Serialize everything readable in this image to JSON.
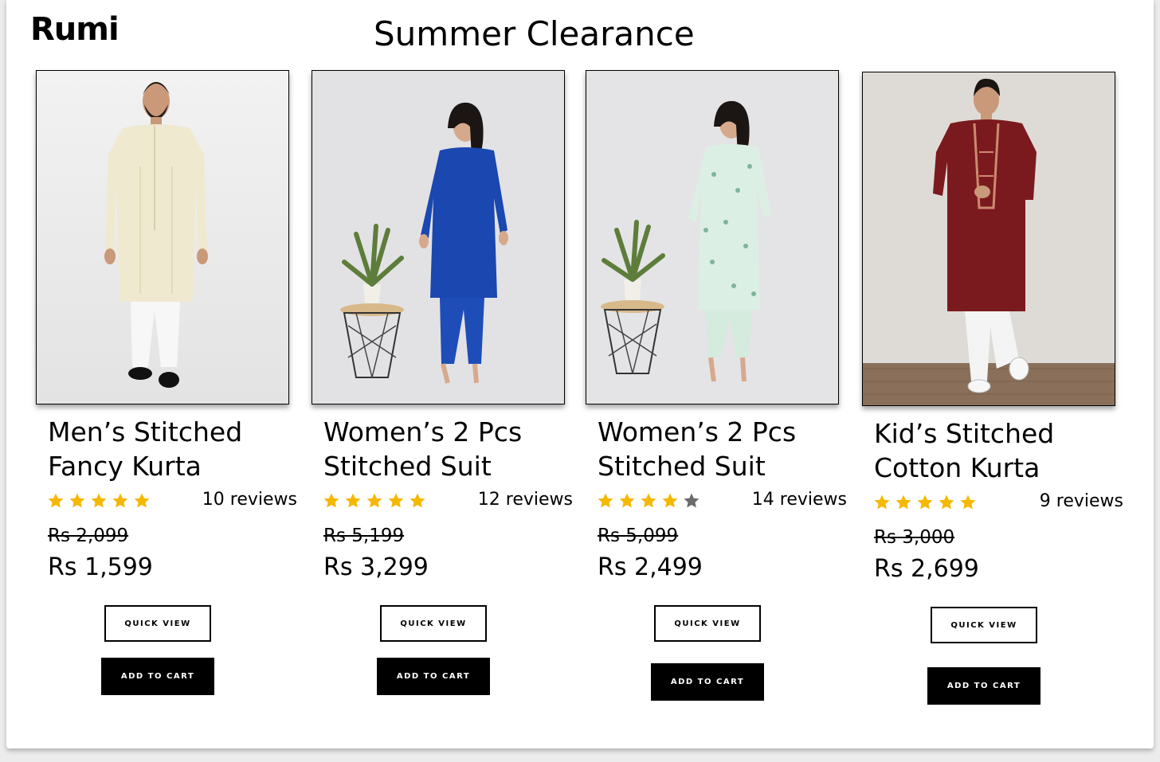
{
  "header": {
    "brand": "Rumi",
    "title": "Summer Clearance"
  },
  "colors": {
    "star_filled": "#F5B800",
    "star_empty": "#6B6B6B",
    "button_dark": "#000000"
  },
  "products": [
    {
      "name_line1": "Men’s Stitched",
      "name_line2": "Fancy Kurta",
      "rating": 5,
      "reviews": "10 reviews",
      "old_price": "Rs 2,099",
      "price": "Rs 1,599",
      "quick_view_label": "QUICK VIEW",
      "add_to_cart_label": "ADD TO CART"
    },
    {
      "name_line1": "Women’s 2 Pcs",
      "name_line2": "Stitched Suit",
      "rating": 5,
      "reviews": "12 reviews",
      "old_price": "Rs 5,199",
      "price": "Rs 3,299",
      "quick_view_label": "QUICK VIEW",
      "add_to_cart_label": "ADD TO CART"
    },
    {
      "name_line1": "Women’s 2 Pcs",
      "name_line2": "Stitched Suit",
      "rating": 4,
      "reviews": "14 reviews",
      "old_price": "Rs 5,099",
      "price": "Rs 2,499",
      "quick_view_label": "QUICK VIEW",
      "add_to_cart_label": "ADD TO CART"
    },
    {
      "name_line1": "Kid’s Stitched",
      "name_line2": "Cotton Kurta",
      "rating": 5,
      "reviews": "9 reviews",
      "old_price": "Rs 3,000",
      "price": "Rs 2,699",
      "quick_view_label": "QUICK VIEW",
      "add_to_cart_label": "ADD TO CART"
    }
  ]
}
